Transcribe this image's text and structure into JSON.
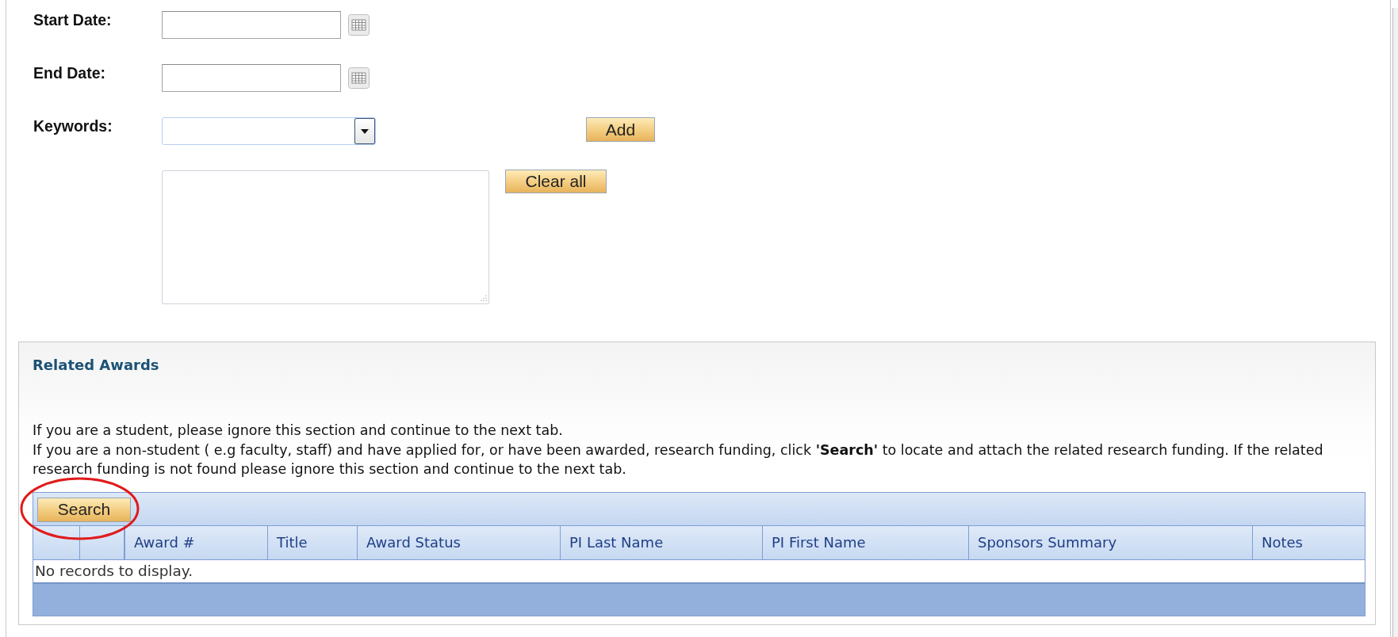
{
  "form": {
    "fields": [
      {
        "label": "Start Date:",
        "kind": "date"
      },
      {
        "label": "End Date:",
        "kind": "date"
      },
      {
        "label": "Keywords:",
        "kind": "dropdown",
        "button": "Add"
      }
    ],
    "keyword_list": {
      "button": "Clear all"
    }
  },
  "related_awards": {
    "title": "Related Awards",
    "paragraphs": [
      "If you are a student, please ignore this section and continue to the next tab.",
      "If you are a non-student ( e.g faculty, staff) and have applied for, or have been awarded, research funding, click **'Search'** to locate and attach the related research funding. If the related research funding is not found please ignore this section and continue to the next tab."
    ],
    "search_button": {
      "label": "Search",
      "circled": true
    },
    "table": {
      "columns": [
        "Award #",
        "Title",
        "Award Status",
        "PI Last Name",
        "PI First Name",
        "Sponsors Summary",
        "Notes"
      ],
      "empty_message": "No records to display."
    }
  }
}
